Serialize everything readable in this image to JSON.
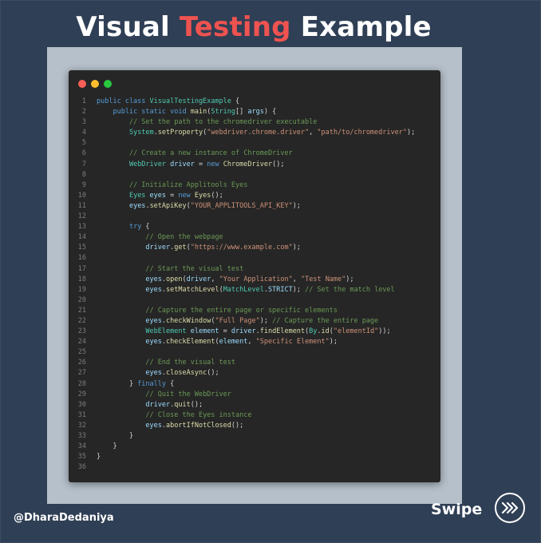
{
  "header": {
    "title_part1": "Visual ",
    "title_accent": "Testing",
    "title_part2": " Example",
    "accent_color": "#ef5350"
  },
  "editor": {
    "window_controls": [
      "close-dot-red",
      "minimize-dot-yellow",
      "maximize-dot-green"
    ],
    "lines": [
      {
        "n": "1",
        "segs": [
          [
            "k",
            "public class "
          ],
          [
            "t",
            "VisualTestingExample"
          ],
          [
            "p",
            " {"
          ]
        ]
      },
      {
        "n": "2",
        "segs": [
          [
            "p",
            "    "
          ],
          [
            "k",
            "public static void "
          ],
          [
            "f",
            "main"
          ],
          [
            "p",
            "("
          ],
          [
            "t",
            "String"
          ],
          [
            "p",
            "[] "
          ],
          [
            "v",
            "args"
          ],
          [
            "p",
            ") {"
          ]
        ]
      },
      {
        "n": "3",
        "segs": [
          [
            "p",
            "        "
          ],
          [
            "c",
            "// Set the path to the chromedriver executable"
          ]
        ]
      },
      {
        "n": "4",
        "segs": [
          [
            "p",
            "        "
          ],
          [
            "t",
            "System"
          ],
          [
            "p",
            "."
          ],
          [
            "f",
            "setProperty"
          ],
          [
            "p",
            "("
          ],
          [
            "s",
            "\"webdriver.chrome.driver\""
          ],
          [
            "p",
            ", "
          ],
          [
            "s",
            "\"path/to/chromedriver\""
          ],
          [
            "p",
            ");"
          ]
        ]
      },
      {
        "n": "5",
        "segs": []
      },
      {
        "n": "6",
        "segs": [
          [
            "p",
            "        "
          ],
          [
            "c",
            "// Create a new instance of ChromeDriver"
          ]
        ]
      },
      {
        "n": "7",
        "segs": [
          [
            "p",
            "        "
          ],
          [
            "t",
            "WebDriver "
          ],
          [
            "v",
            "driver"
          ],
          [
            "p",
            " = "
          ],
          [
            "k",
            "new "
          ],
          [
            "f",
            "ChromeDriver"
          ],
          [
            "p",
            "();"
          ]
        ]
      },
      {
        "n": "8",
        "segs": []
      },
      {
        "n": "9",
        "segs": [
          [
            "p",
            "        "
          ],
          [
            "c",
            "// Initialize Applitools Eyes"
          ]
        ]
      },
      {
        "n": "10",
        "segs": [
          [
            "p",
            "        "
          ],
          [
            "t",
            "Eyes "
          ],
          [
            "v",
            "eyes"
          ],
          [
            "p",
            " = "
          ],
          [
            "k",
            "new "
          ],
          [
            "f",
            "Eyes"
          ],
          [
            "p",
            "();"
          ]
        ]
      },
      {
        "n": "11",
        "segs": [
          [
            "p",
            "        "
          ],
          [
            "v",
            "eyes"
          ],
          [
            "p",
            "."
          ],
          [
            "f",
            "setApiKey"
          ],
          [
            "p",
            "("
          ],
          [
            "s",
            "\"YOUR_APPLITOOLS_API_KEY\""
          ],
          [
            "p",
            ");"
          ]
        ]
      },
      {
        "n": "12",
        "segs": []
      },
      {
        "n": "13",
        "segs": [
          [
            "p",
            "        "
          ],
          [
            "k",
            "try"
          ],
          [
            "p",
            " {"
          ]
        ]
      },
      {
        "n": "14",
        "segs": [
          [
            "p",
            "            "
          ],
          [
            "c",
            "// Open the webpage"
          ]
        ]
      },
      {
        "n": "15",
        "segs": [
          [
            "p",
            "            "
          ],
          [
            "v",
            "driver"
          ],
          [
            "p",
            "."
          ],
          [
            "f",
            "get"
          ],
          [
            "p",
            "("
          ],
          [
            "s",
            "\"https://www.example.com\""
          ],
          [
            "p",
            ");"
          ]
        ]
      },
      {
        "n": "16",
        "segs": []
      },
      {
        "n": "17",
        "segs": [
          [
            "p",
            "            "
          ],
          [
            "c",
            "// Start the visual test"
          ]
        ]
      },
      {
        "n": "18",
        "segs": [
          [
            "p",
            "            "
          ],
          [
            "v",
            "eyes"
          ],
          [
            "p",
            "."
          ],
          [
            "f",
            "open"
          ],
          [
            "p",
            "("
          ],
          [
            "v",
            "driver"
          ],
          [
            "p",
            ", "
          ],
          [
            "s",
            "\"Your Application\""
          ],
          [
            "p",
            ", "
          ],
          [
            "s",
            "\"Test Name\""
          ],
          [
            "p",
            ");"
          ]
        ]
      },
      {
        "n": "19",
        "segs": [
          [
            "p",
            "            "
          ],
          [
            "v",
            "eyes"
          ],
          [
            "p",
            "."
          ],
          [
            "f",
            "setMatchLevel"
          ],
          [
            "p",
            "("
          ],
          [
            "t",
            "MatchLevel"
          ],
          [
            "p",
            "."
          ],
          [
            "v",
            "STRICT"
          ],
          [
            "p",
            "); "
          ],
          [
            "c",
            "// Set the match level"
          ]
        ]
      },
      {
        "n": "20",
        "segs": []
      },
      {
        "n": "21",
        "segs": [
          [
            "p",
            "            "
          ],
          [
            "c",
            "// Capture the entire page or specific elements"
          ]
        ]
      },
      {
        "n": "22",
        "segs": [
          [
            "p",
            "            "
          ],
          [
            "v",
            "eyes"
          ],
          [
            "p",
            "."
          ],
          [
            "f",
            "checkWindow"
          ],
          [
            "p",
            "("
          ],
          [
            "s",
            "\"Full Page\""
          ],
          [
            "p",
            "); "
          ],
          [
            "c",
            "// Capture the entire page"
          ]
        ]
      },
      {
        "n": "23",
        "segs": [
          [
            "p",
            "            "
          ],
          [
            "t",
            "WebElement "
          ],
          [
            "v",
            "element"
          ],
          [
            "p",
            " = "
          ],
          [
            "v",
            "driver"
          ],
          [
            "p",
            "."
          ],
          [
            "f",
            "findElement"
          ],
          [
            "p",
            "("
          ],
          [
            "t",
            "By"
          ],
          [
            "p",
            "."
          ],
          [
            "f",
            "id"
          ],
          [
            "p",
            "("
          ],
          [
            "s",
            "\"elementId\""
          ],
          [
            "p",
            "));"
          ]
        ]
      },
      {
        "n": "24",
        "segs": [
          [
            "p",
            "            "
          ],
          [
            "v",
            "eyes"
          ],
          [
            "p",
            "."
          ],
          [
            "f",
            "checkElement"
          ],
          [
            "p",
            "("
          ],
          [
            "v",
            "element"
          ],
          [
            "p",
            ", "
          ],
          [
            "s",
            "\"Specific Element\""
          ],
          [
            "p",
            ");"
          ]
        ]
      },
      {
        "n": "25",
        "segs": []
      },
      {
        "n": "26",
        "segs": [
          [
            "p",
            "            "
          ],
          [
            "c",
            "// End the visual test"
          ]
        ]
      },
      {
        "n": "27",
        "segs": [
          [
            "p",
            "            "
          ],
          [
            "v",
            "eyes"
          ],
          [
            "p",
            "."
          ],
          [
            "f",
            "closeAsync"
          ],
          [
            "p",
            "();"
          ]
        ]
      },
      {
        "n": "28",
        "segs": [
          [
            "p",
            "        } "
          ],
          [
            "k",
            "finally"
          ],
          [
            "p",
            " {"
          ]
        ]
      },
      {
        "n": "29",
        "segs": [
          [
            "p",
            "            "
          ],
          [
            "c",
            "// Quit the WebDriver"
          ]
        ]
      },
      {
        "n": "30",
        "segs": [
          [
            "p",
            "            "
          ],
          [
            "v",
            "driver"
          ],
          [
            "p",
            "."
          ],
          [
            "f",
            "quit"
          ],
          [
            "p",
            "();"
          ]
        ]
      },
      {
        "n": "31",
        "segs": [
          [
            "p",
            "            "
          ],
          [
            "c",
            "// Close the Eyes instance"
          ]
        ]
      },
      {
        "n": "32",
        "segs": [
          [
            "p",
            "            "
          ],
          [
            "v",
            "eyes"
          ],
          [
            "p",
            "."
          ],
          [
            "f",
            "abortIfNotClosed"
          ],
          [
            "p",
            "();"
          ]
        ]
      },
      {
        "n": "33",
        "segs": [
          [
            "p",
            "        }"
          ]
        ]
      },
      {
        "n": "34",
        "segs": [
          [
            "p",
            "    }"
          ]
        ]
      },
      {
        "n": "35",
        "segs": [
          [
            "p",
            "}"
          ]
        ]
      },
      {
        "n": "36",
        "segs": []
      }
    ]
  },
  "footer": {
    "handle": "@DharaDedaniya",
    "swipe_label": "Swipe",
    "swipe_icon": "double-chevron-right-icon"
  }
}
